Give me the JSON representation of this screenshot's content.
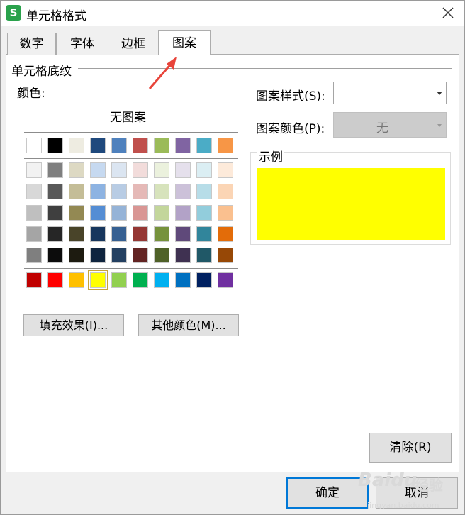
{
  "window": {
    "title": "单元格格式",
    "app_icon_letter": "S"
  },
  "tabs": [
    {
      "label": "数字",
      "active": false
    },
    {
      "label": "字体",
      "active": false
    },
    {
      "label": "边框",
      "active": false
    },
    {
      "label": "图案",
      "active": true
    }
  ],
  "shading": {
    "group_label": "单元格底纹",
    "color_label": "颜色:",
    "no_pattern_label": "无图案",
    "theme_row": [
      "#ffffff",
      "#000000",
      "#eeece1",
      "#1f497d",
      "#4f81bd",
      "#c0504d",
      "#9bbb59",
      "#8064a2",
      "#4bacc6",
      "#f79646"
    ],
    "shade_rows": [
      [
        "#f2f2f2",
        "#7f7f7f",
        "#ddd9c3",
        "#c6d9f0",
        "#dbe5f1",
        "#f2dcdb",
        "#ebf1dd",
        "#e5e0ec",
        "#dbeef3",
        "#fdeada"
      ],
      [
        "#d8d8d8",
        "#595959",
        "#c4bd97",
        "#8db3e2",
        "#b8cce4",
        "#e5b9b7",
        "#d7e3bc",
        "#ccc1d9",
        "#b7dde8",
        "#fbd5b5"
      ],
      [
        "#bfbfbf",
        "#3f3f3f",
        "#938953",
        "#548dd4",
        "#95b3d7",
        "#d99694",
        "#c3d69b",
        "#b2a2c7",
        "#92cddc",
        "#fac08f"
      ],
      [
        "#a5a5a5",
        "#262626",
        "#494429",
        "#17365d",
        "#366092",
        "#953734",
        "#76923c",
        "#5f497a",
        "#31859b",
        "#e36c09"
      ],
      [
        "#7f7f7f",
        "#0c0c0c",
        "#1d1b10",
        "#0f243e",
        "#244061",
        "#632423",
        "#4f6128",
        "#3f3151",
        "#205867",
        "#974806"
      ]
    ],
    "standard_row": [
      "#c00000",
      "#ff0000",
      "#ffc000",
      "#ffff00",
      "#92d050",
      "#00b050",
      "#00b0f0",
      "#0070c0",
      "#002060",
      "#7030a0"
    ],
    "selected_color": "#ffff00",
    "fill_effects_button": "填充效果(I)...",
    "more_colors_button": "其他颜色(M)..."
  },
  "pattern": {
    "style_label": "图案样式(S):",
    "style_value": "",
    "color_label": "图案颜色(P):",
    "color_value": "无"
  },
  "sample": {
    "label": "示例",
    "fill_color": "#ffff00"
  },
  "buttons": {
    "clear": "清除(R)",
    "ok": "确定",
    "cancel": "取消"
  },
  "watermark": {
    "brand": "Baidu",
    "sub": "经验",
    "url": "jingyan.baidu.com"
  },
  "colors": {
    "annotation_arrow": "#e8443a",
    "accent_border": "#0078d7"
  }
}
